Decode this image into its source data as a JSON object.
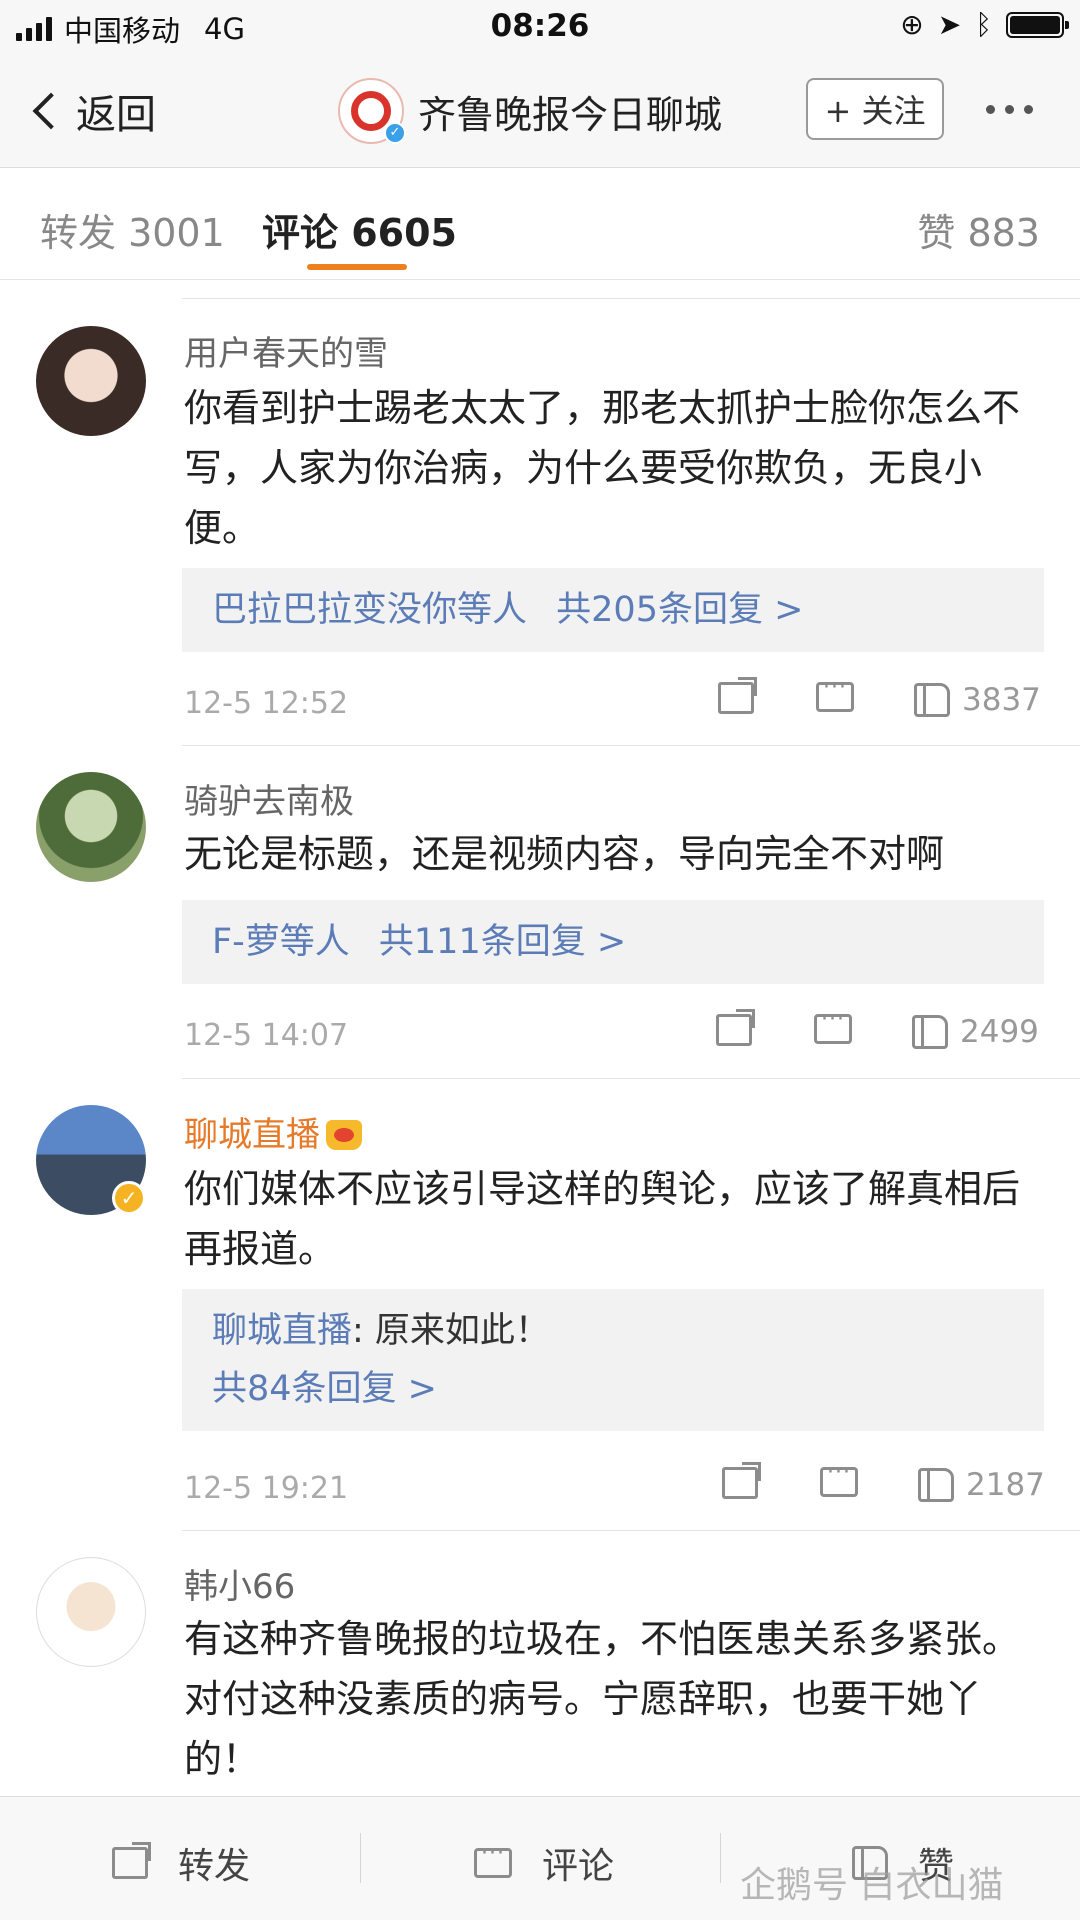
{
  "status_bar": {
    "carrier": "中国移动",
    "network": "4G",
    "time": "08:26"
  },
  "nav": {
    "back_label": "返回",
    "account_name": "齐鲁晚报今日聊城",
    "follow_label": "+ 关注"
  },
  "tabs": {
    "repost": "转发 3001",
    "comment": "评论 6605",
    "like": "赞 883"
  },
  "comments": [
    {
      "name": "用户春天的雪",
      "text": "你看到护士踢老太太了，那老太抓护士脸你怎么不写，人家为你治病，为什么要受你欺负，无良小便。",
      "reply_users": "巴拉巴拉变没你等人",
      "reply_count": "共205条回复 >",
      "time": "12-5 12:52",
      "likes": "3837"
    },
    {
      "name": "骑驴去南极",
      "text": "无论是标题，还是视频内容，导向完全不对啊",
      "reply_users": "F-萝等人",
      "reply_count": "共111条回复 >",
      "time": "12-5 14:07",
      "likes": "2499"
    },
    {
      "name": "聊城直播",
      "text": "你们媒体不应该引导这样的舆论，应该了解真相后再报道。",
      "reply_author": "聊城直播",
      "reply_text": ": 原来如此！",
      "reply_count": "共84条回复 >",
      "time": "12-5 19:21",
      "likes": "2187"
    },
    {
      "name": "韩小66",
      "text": "有这种齐鲁晚报的垃圾在，不怕医患关系多紧张。对付这种没素质的病号。宁愿辞职，也要干她丫的！"
    }
  ],
  "toolbar": {
    "repost": "转发",
    "comment": "评论",
    "like": "赞"
  },
  "watermark": "企鹅号 白衣山猫"
}
